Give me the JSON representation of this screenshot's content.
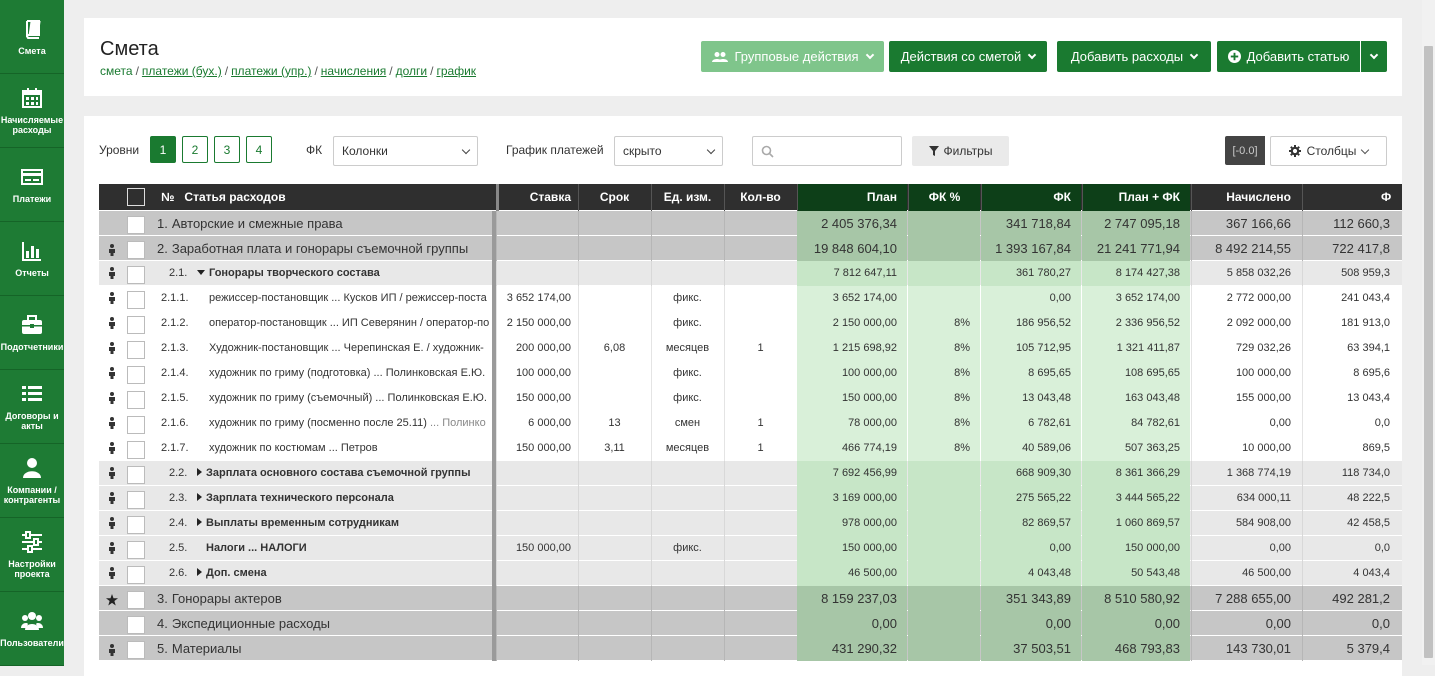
{
  "sidebar": {
    "items": [
      {
        "label": "Смета",
        "icon": "book-icon"
      },
      {
        "label": "Начисляемые расходы",
        "icon": "calendar-icon"
      },
      {
        "label": "Платежи",
        "icon": "payments-icon"
      },
      {
        "label": "Отчеты",
        "icon": "bar-chart-icon"
      },
      {
        "label": "Подотчетники",
        "icon": "briefcase-icon"
      },
      {
        "label": "Договоры и акты",
        "icon": "list-icon"
      },
      {
        "label": "Компании / контрагенты",
        "icon": "user-icon"
      },
      {
        "label": "Настройки проекта",
        "icon": "sliders-icon"
      },
      {
        "label": "Пользователи",
        "icon": "users-icon"
      }
    ]
  },
  "header": {
    "title": "Смета",
    "breadcrumb": {
      "current": "смета",
      "links": [
        "платежи (бух.)",
        "платежи (упр.)",
        "начисления",
        "долги",
        "график"
      ]
    },
    "buttons": {
      "group_actions": "Групповые действия",
      "estimate_actions": "Действия со сметой",
      "add_expenses": "Добавить расходы",
      "add_item": "Добавить статью"
    }
  },
  "toolbar": {
    "levels_label": "Уровни",
    "levels": [
      "1",
      "2",
      "3",
      "4"
    ],
    "fk_label": "ФК",
    "fk_value": "Колонки",
    "schedule_label": "График платежей",
    "schedule_value": "скрыто",
    "search_placeholder": "",
    "filters": "Фильтры",
    "zero": "[-0.0]",
    "columns": "Столбцы"
  },
  "table": {
    "headers": {
      "num": "№",
      "name": "Статья расходов",
      "rate": "Ставка",
      "term": "Срок",
      "unit": "Ед. изм.",
      "qty": "Кол-во",
      "plan": "План",
      "fk_pct": "ФК %",
      "fk": "ФК",
      "plan_fk": "План + ФК",
      "accrued": "Начислено",
      "f2": "Ф"
    },
    "rows": [
      {
        "level": 1,
        "icon": "",
        "code": "1.",
        "name": "Авторские и смежные права",
        "rate": "",
        "term": "",
        "unit": "",
        "qty": "",
        "plan": "2 405 376,34",
        "fk_pct": "",
        "fk": "341 718,84",
        "plan_fk": "2 747 095,18",
        "accrued": "367 166,66",
        "f2": "112 660,3"
      },
      {
        "level": 1,
        "icon": "person",
        "code": "2.",
        "name": "Заработная плата и гонорары съемочной группы",
        "rate": "",
        "term": "",
        "unit": "",
        "qty": "",
        "plan": "19 848 604,10",
        "fk_pct": "",
        "fk": "1 393 167,84",
        "plan_fk": "21 241 771,94",
        "accrued": "8 492 214,55",
        "f2": "722 417,8"
      },
      {
        "level": 2,
        "icon": "person",
        "code": "2.1.",
        "expand": "down",
        "name": "Гонорары творческого состава",
        "rate": "",
        "term": "",
        "unit": "",
        "qty": "",
        "plan": "7 812 647,11",
        "fk_pct": "",
        "fk": "361 780,27",
        "plan_fk": "8 174 427,38",
        "accrued": "5 858 032,26",
        "f2": "508 959,3"
      },
      {
        "level": 3,
        "icon": "person",
        "code": "2.1.1.",
        "name": "режиссер-постановщик ... Кусков ИП / режиссер-поста",
        "rate": "3 652 174,00",
        "term": "",
        "unit": "фикс.",
        "qty": "",
        "plan": "3 652 174,00",
        "fk_pct": "",
        "fk": "0,00",
        "plan_fk": "3 652 174,00",
        "accrued": "2 772 000,00",
        "f2": "241 043,4"
      },
      {
        "level": 3,
        "icon": "person",
        "code": "2.1.2.",
        "name": "оператор-постановщик ... ИП Северянин / оператор-по",
        "rate": "2 150 000,00",
        "term": "",
        "unit": "фикс.",
        "qty": "",
        "plan": "2 150 000,00",
        "fk_pct": "8%",
        "fk": "186 956,52",
        "plan_fk": "2 336 956,52",
        "accrued": "2 092 000,00",
        "f2": "181 913,0"
      },
      {
        "level": 3,
        "icon": "person",
        "code": "2.1.3.",
        "name": "Художник-постановщик ... Черепинская Е. / художник-",
        "rate": "200 000,00",
        "term": "6,08",
        "unit": "месяцев",
        "qty": "1",
        "plan": "1 215 698,92",
        "fk_pct": "8%",
        "fk": "105 712,95",
        "plan_fk": "1 321 411,87",
        "accrued": "729 032,26",
        "f2": "63 394,1"
      },
      {
        "level": 3,
        "icon": "person",
        "code": "2.1.4.",
        "name": "художник по гриму (подготовка) ... Полинковская Е.Ю.",
        "rate": "100 000,00",
        "term": "",
        "unit": "фикс.",
        "qty": "",
        "plan": "100 000,00",
        "fk_pct": "8%",
        "fk": "8 695,65",
        "plan_fk": "108 695,65",
        "accrued": "100 000,00",
        "f2": "8 695,6"
      },
      {
        "level": 3,
        "icon": "person",
        "code": "2.1.5.",
        "name": "художник по гриму (съемочный) ... Полинковская Е.Ю.",
        "rate": "150 000,00",
        "term": "",
        "unit": "фикс.",
        "qty": "",
        "plan": "150 000,00",
        "fk_pct": "8%",
        "fk": "13 043,48",
        "plan_fk": "163 043,48",
        "accrued": "155 000,00",
        "f2": "13 043,4"
      },
      {
        "level": 3,
        "icon": "person",
        "code": "2.1.6.",
        "name": "художник по гриму (посменно после 25.11)",
        "name_grey": "... Полинко",
        "rate": "6 000,00",
        "term": "13",
        "unit": "смен",
        "qty": "1",
        "plan": "78 000,00",
        "fk_pct": "8%",
        "fk": "6 782,61",
        "plan_fk": "84 782,61",
        "accrued": "0,00",
        "f2": "0,0"
      },
      {
        "level": 3,
        "icon": "person",
        "code": "2.1.7.",
        "name": "художник по костюмам ... Петров",
        "rate": "150 000,00",
        "term": "3,11",
        "unit": "месяцев",
        "qty": "1",
        "plan": "466 774,19",
        "fk_pct": "8%",
        "fk": "40 589,06",
        "plan_fk": "507 363,25",
        "accrued": "10 000,00",
        "f2": "869,5"
      },
      {
        "level": 2,
        "icon": "person",
        "code": "2.2.",
        "expand": "right",
        "name": "Зарплата основного состава съемочной группы",
        "rate": "",
        "term": "",
        "unit": "",
        "qty": "",
        "plan": "7 692 456,99",
        "fk_pct": "",
        "fk": "668 909,30",
        "plan_fk": "8 361 366,29",
        "accrued": "1 368 774,19",
        "f2": "118 734,0"
      },
      {
        "level": 2,
        "icon": "person",
        "code": "2.3.",
        "expand": "right",
        "name": "Зарплата технического персонала",
        "rate": "",
        "term": "",
        "unit": "",
        "qty": "",
        "plan": "3 169 000,00",
        "fk_pct": "",
        "fk": "275 565,22",
        "plan_fk": "3 444 565,22",
        "accrued": "634 000,11",
        "f2": "48 222,5"
      },
      {
        "level": 2,
        "icon": "person",
        "code": "2.4.",
        "expand": "right",
        "name": "Выплаты временным сотрудникам",
        "rate": "",
        "term": "",
        "unit": "",
        "qty": "",
        "plan": "978 000,00",
        "fk_pct": "",
        "fk": "82 869,57",
        "plan_fk": "1 060 869,57",
        "accrued": "584 908,00",
        "f2": "42 458,5"
      },
      {
        "level": 2,
        "icon": "person",
        "code": "2.5.",
        "expand": "none",
        "name": "Налоги ... НАЛОГИ",
        "rate": "150 000,00",
        "term": "",
        "unit": "фикс.",
        "qty": "",
        "plan": "150 000,00",
        "fk_pct": "",
        "fk": "0,00",
        "plan_fk": "150 000,00",
        "accrued": "0,00",
        "f2": "0,0"
      },
      {
        "level": 2,
        "icon": "person",
        "code": "2.6.",
        "expand": "right",
        "name": "Доп. смена",
        "rate": "",
        "term": "",
        "unit": "",
        "qty": "",
        "plan": "46 500,00",
        "fk_pct": "",
        "fk": "4 043,48",
        "plan_fk": "50 543,48",
        "accrued": "46 500,00",
        "f2": "4 043,4"
      },
      {
        "level": 1,
        "icon": "star",
        "code": "3.",
        "name": "Гонорары актеров",
        "rate": "",
        "term": "",
        "unit": "",
        "qty": "",
        "plan": "8 159 237,03",
        "fk_pct": "",
        "fk": "351 343,89",
        "plan_fk": "8 510 580,92",
        "accrued": "7 288 655,00",
        "f2": "492 281,2"
      },
      {
        "level": 1,
        "icon": "",
        "code": "4.",
        "name": "Экспедиционные расходы",
        "rate": "",
        "term": "",
        "unit": "",
        "qty": "",
        "plan": "0,00",
        "fk_pct": "",
        "fk": "0,00",
        "plan_fk": "0,00",
        "accrued": "0,00",
        "f2": "0,0"
      },
      {
        "level": 1,
        "icon": "person",
        "code": "5.",
        "name": "Материалы",
        "rate": "",
        "term": "",
        "unit": "",
        "qty": "",
        "plan": "431 290,32",
        "fk_pct": "",
        "fk": "37 503,51",
        "plan_fk": "468 793,83",
        "accrued": "143 730,01",
        "f2": "5 379,4"
      }
    ]
  }
}
